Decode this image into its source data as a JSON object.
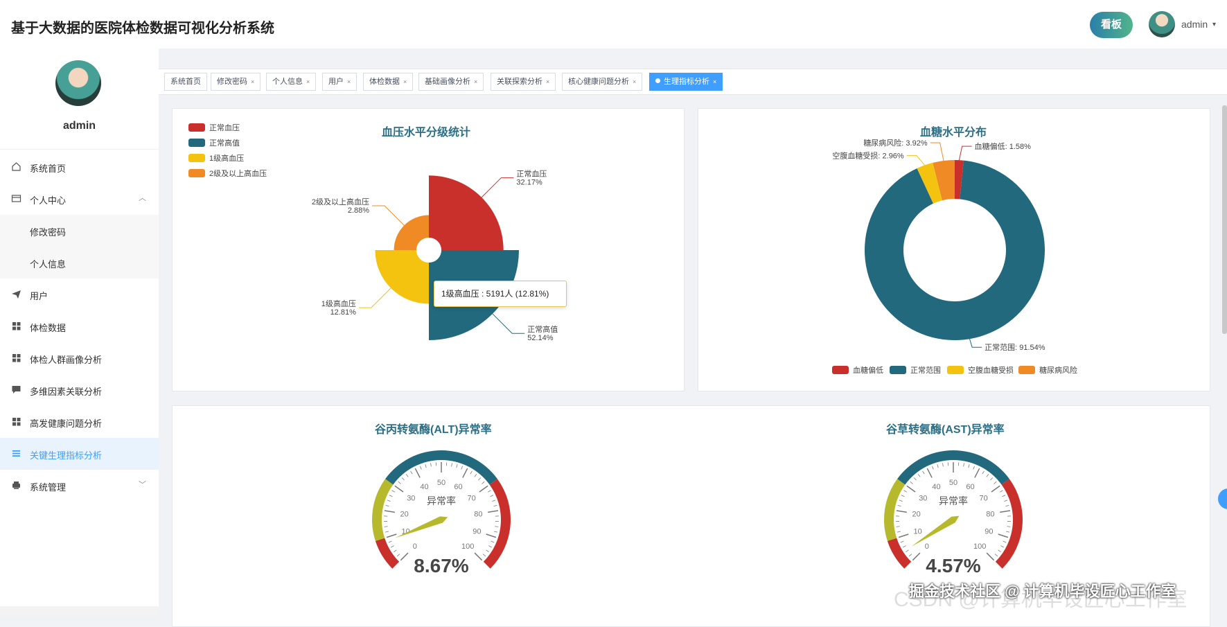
{
  "header": {
    "title": "基于大数据的医院体检数据可视化分析系统",
    "board_label": "看板",
    "user": "admin",
    "caret": "▾"
  },
  "sidebar": {
    "user": "admin",
    "items": [
      {
        "label": "系统首页",
        "icon": "home-icon"
      },
      {
        "label": "个人中心",
        "icon": "id-card-icon"
      },
      {
        "label": "修改密码"
      },
      {
        "label": "个人信息"
      },
      {
        "label": "用户",
        "icon": "send-icon"
      },
      {
        "label": "体检数据",
        "icon": "grid-icon"
      },
      {
        "label": "体检人群画像分析",
        "icon": "grid-icon"
      },
      {
        "label": "多维因素关联分析",
        "icon": "chat-icon"
      },
      {
        "label": "高发健康问题分析",
        "icon": "grid-icon"
      },
      {
        "label": "关键生理指标分析",
        "icon": "list-icon"
      },
      {
        "label": "系统管理",
        "icon": "printer-icon"
      }
    ]
  },
  "tabs": [
    {
      "label": "系统首页",
      "closable": false
    },
    {
      "label": "修改密码",
      "closable": true
    },
    {
      "label": "个人信息",
      "closable": true
    },
    {
      "label": "用户",
      "closable": true
    },
    {
      "label": "体检数据",
      "closable": true
    },
    {
      "label": "基础画像分析",
      "closable": true
    },
    {
      "label": "关联探索分析",
      "closable": true
    },
    {
      "label": "核心健康问题分析",
      "closable": true
    },
    {
      "label": "生理指标分析",
      "closable": true,
      "active": true
    }
  ],
  "tab_close": "×",
  "colors": {
    "red": "#c9302c",
    "teal": "#22697d",
    "yellow": "#f4c30f",
    "orange": "#f08a24",
    "olive": "#b6b92b",
    "accent": "#409eff"
  },
  "chart_data": [
    {
      "type": "pie",
      "subtype": "rose",
      "title": "血压水平分级统计",
      "legend": [
        "正常血压",
        "正常高值",
        "1级高血压",
        "2级及以上高血压"
      ],
      "legend_position": "top-left",
      "slices": [
        {
          "name": "正常血压",
          "percent": 32.17,
          "label": "32.17%"
        },
        {
          "name": "正常高值",
          "percent": 52.14,
          "label": "52.14%"
        },
        {
          "name": "1级高血压",
          "percent": 12.81,
          "label": "12.81%"
        },
        {
          "name": "2级及以上高血压",
          "percent": 2.88,
          "label": "2.88%"
        }
      ],
      "tooltip": "1级高血压 : 5191人 (12.81%)"
    },
    {
      "type": "pie",
      "subtype": "donut",
      "title": "血糖水平分布",
      "legend": [
        "血糖偏低",
        "正常范围",
        "空腹血糖受损",
        "糖尿病风险"
      ],
      "legend_position": "bottom",
      "slices": [
        {
          "name": "血糖偏低",
          "percent": 1.58,
          "label": "血糖偏低: 1.58%"
        },
        {
          "name": "正常范围",
          "percent": 91.54,
          "label": "正常范围: 91.54%"
        },
        {
          "name": "空腹血糖受损",
          "percent": 2.96,
          "label": "空腹血糖受损: 2.96%"
        },
        {
          "name": "糖尿病风险",
          "percent": 3.92,
          "label": "糖尿病风险: 3.92%"
        }
      ]
    },
    {
      "type": "gauge",
      "title": "谷丙转氨酶(ALT)异常率",
      "name": "异常率",
      "value": 8.67,
      "display": "8.67%",
      "min": 0,
      "max": 100,
      "ticks": [
        "0",
        "10",
        "20",
        "30",
        "40",
        "50",
        "60",
        "70",
        "80",
        "90",
        "100"
      ]
    },
    {
      "type": "gauge",
      "title": "谷草转氨酶(AST)异常率",
      "name": "异常率",
      "value": 4.57,
      "display": "4.57%",
      "min": 0,
      "max": 100,
      "ticks": [
        "0",
        "10",
        "20",
        "30",
        "40",
        "50",
        "60",
        "70",
        "80",
        "90",
        "100"
      ]
    }
  ],
  "watermark": "掘金技术社区 @ 计算机毕设匠心工作室",
  "watermark2": "CSDN @计算机毕设匠心工作室"
}
